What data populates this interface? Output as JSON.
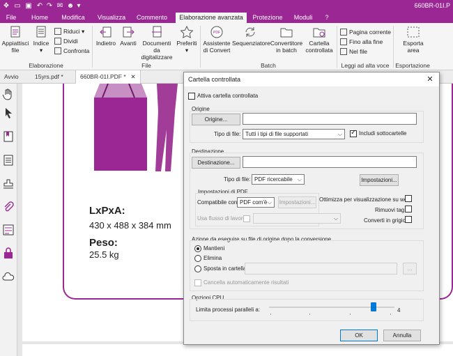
{
  "titlebar": {
    "doc_title": "660BR-01I.P"
  },
  "menu": [
    "File",
    "Home",
    "Modifica",
    "Visualizza",
    "Commento",
    "Elaborazione avanzata",
    "Protezione",
    "Moduli",
    "?"
  ],
  "ribbon": {
    "elaborazione": {
      "label": "Elaborazione",
      "appiattisci": "Appiattisci\nfile",
      "indice": "Indice",
      "riduci": "Riduci",
      "dividi": "Dividi",
      "confronta": "Confronta"
    },
    "file": {
      "label": "File",
      "indietro": "Indietro",
      "avanti": "Avanti",
      "documenti": "Documenti da\ndigitalizzare",
      "preferiti": "Preferiti"
    },
    "batch": {
      "label": "Batch",
      "assistente": "Assistente\ndi Convert",
      "sequenziatore": "Sequenziatore",
      "convertitore": "Convertitore\nin batch",
      "cartella": "Cartella\ncontrollata"
    },
    "leggi": {
      "label": "Leggi ad alta voce",
      "pagina": "Pagina corrente",
      "fino": "Fino alla fine",
      "nel": "Nel file"
    },
    "esportazione": {
      "label": "Esportazione",
      "esporta": "Esporta\narea"
    }
  },
  "doctabs": [
    "Avvio",
    "15yrs.pdf *",
    "660BR-01I.PDF *"
  ],
  "document": {
    "dim_label": "LxPxA:",
    "dim_value": "430 x 488 x 384 mm",
    "peso_label": "Peso:",
    "peso_value": "25.5 kg"
  },
  "dialog": {
    "title": "Cartella controllata",
    "attiva": "Attiva cartella controllata",
    "origine": {
      "group": "Origine",
      "button": "Origine...",
      "path": "",
      "tipo_label": "Tipo di file:",
      "tipo_value": "Tutti i tipi di file supportati",
      "includi": "Includi sottocartelle"
    },
    "destinazione": {
      "group": "Destinazione",
      "button": "Destinazione...",
      "path": "",
      "tipo_label": "Tipo di file:",
      "tipo_value": "PDF ricercabile",
      "impostazioni": "Impostazioni..."
    },
    "impostazioni_pdf": {
      "group": "Impostazioni di PDF",
      "compat_label": "Compatibile con:",
      "compat_value": "PDF com'è",
      "impostazioni": "Impostazioni...",
      "ottimizza": "Ottimizza per visualizzazione su web",
      "rimuovi": "Rimuovi tag",
      "converti": "Converti in grigio",
      "flusso": "Usa flusso di lavoro"
    },
    "azione": {
      "group": "Azione da eseguire su file di origine dopo la conversione",
      "mantieni": "Mantieni",
      "elimina": "Elimina",
      "sposta": "Sposta in cartella",
      "browse": "...",
      "cancella": "Cancella automaticamente risultati"
    },
    "cpu": {
      "group": "Opzioni CPU",
      "label": "Limita processi paralleli a:",
      "value": "4",
      "level": 0.85
    },
    "ok": "OK",
    "cancel": "Annulla"
  }
}
